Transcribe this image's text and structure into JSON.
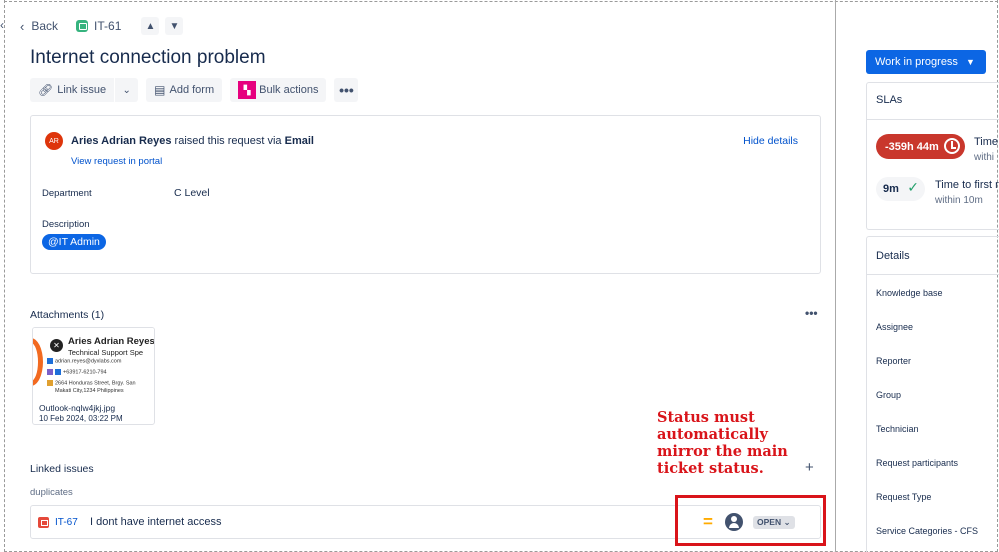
{
  "nav": {
    "back_label": "Back",
    "issue_key": "IT-61",
    "prev_label": "▲",
    "next_label": "▼"
  },
  "issue": {
    "title": "Internet connection problem"
  },
  "toolbar": {
    "link_issue": "Link issue",
    "add_form": "Add form",
    "bulk_actions": "Bulk actions"
  },
  "request": {
    "avatar_initials": "AR",
    "reporter": "Aries Adrian Reyes",
    "raised_text": "raised this request via",
    "channel": "Email",
    "view_portal": "View request in portal",
    "hide_details": "Hide details",
    "department_label": "Department",
    "department_value": "C Level",
    "description_label": "Description",
    "description_mention": "@IT Admin"
  },
  "attachments": {
    "title": "Attachments (1)",
    "more": "•••",
    "file_name": "Outlook-nqlw4jkj.jpg",
    "file_date": "10 Feb 2024, 03:22 PM",
    "thumb_name": "Aries Adrian Reyes",
    "thumb_role": "Technical Support Spe",
    "thumb_email": "adrian.reyes@dyxlabs.com",
    "thumb_phone": "+63917-6210-794",
    "thumb_addr1": "2664 Honduras Street, Brgy. San",
    "thumb_addr2": "Makati City,1234 Philippines"
  },
  "linked": {
    "title": "Linked issues",
    "add": "+",
    "relation": "duplicates",
    "items": [
      {
        "key": "IT-67",
        "summary": "I dont have internet access",
        "priority": "=",
        "status": "OPEN ⌄"
      }
    ]
  },
  "annotation": {
    "text": "Status must automatically mirror the main ticket status.",
    "color": "#d9141a"
  },
  "side": {
    "status_button": "Work in progress",
    "sla_title": "SLAs",
    "sla_items": [
      {
        "badge": "-359h 44m",
        "label": "Time",
        "sub": "withi"
      },
      {
        "badge": "9m",
        "label": "Time to first r",
        "sub": "within 10m"
      }
    ],
    "details_title": "Details",
    "details_fields": [
      "Knowledge base",
      "Assignee",
      "Reporter",
      "Group",
      "Technician",
      "Request participants",
      "Request Type",
      "Service Categories - CFS"
    ]
  },
  "colors": {
    "primary": "#0c66e4",
    "breach": "#c9372c",
    "ok": "#22a06b",
    "link": "#0052cc"
  }
}
